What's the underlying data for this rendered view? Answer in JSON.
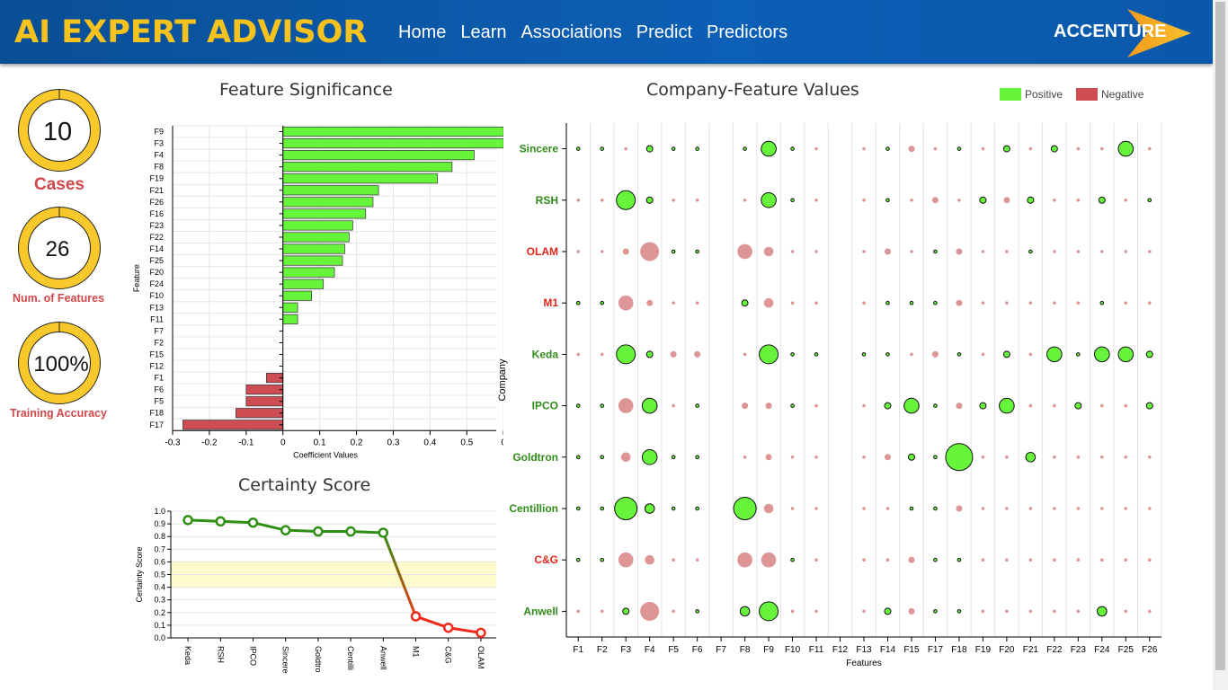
{
  "header": {
    "brand": "AI EXPERT ADVISOR",
    "nav": [
      "Home",
      "Learn",
      "Associations",
      "Predict",
      "Predictors"
    ],
    "logo": "ACCENTURE"
  },
  "colors": {
    "positive": "#66f53a",
    "negative": "#cd4d52",
    "gold": "#f9c82b",
    "bar": "#0b5cb0"
  },
  "kpis": [
    {
      "value": "10",
      "label": "Cases",
      "fill": 1.0
    },
    {
      "value": "26",
      "label": "Num. of Features",
      "fill": 1.0
    },
    {
      "value": "100%",
      "label": "Training Accuracy",
      "fill": 1.0
    }
  ],
  "chart_data": [
    {
      "type": "bar",
      "title": "Feature Significance",
      "xlabel": "Coefficient Values",
      "ylabel": "Feature",
      "xlim": [
        -0.3,
        0.58
      ],
      "xticks": [
        "-0.3",
        "-0.2",
        "-0.1",
        "0",
        "0.1",
        "0.2",
        "0.3",
        "0.4",
        "0.5",
        "0"
      ],
      "categories": [
        "F9",
        "F3",
        "F4",
        "F8",
        "F19",
        "F21",
        "F26",
        "F16",
        "F23",
        "F22",
        "F14",
        "F25",
        "F20",
        "F24",
        "F10",
        "F13",
        "F11",
        "F7",
        "F2",
        "F15",
        "F12",
        "F1",
        "F6",
        "F5",
        "F18",
        "F17"
      ],
      "values": [
        0.6,
        0.6,
        0.52,
        0.46,
        0.42,
        0.26,
        0.245,
        0.225,
        0.19,
        0.18,
        0.168,
        0.162,
        0.14,
        0.11,
        0.078,
        0.04,
        0.04,
        0,
        0,
        0,
        0,
        -0.045,
        -0.1,
        -0.1,
        -0.128,
        -0.272
      ]
    },
    {
      "type": "line",
      "title": "Certainty Score",
      "ylabel": "Certainty Score",
      "ylim": [
        0,
        1
      ],
      "yticks": [
        "0.0",
        "0.1",
        "0.2",
        "0.3",
        "0.4",
        "0.5",
        "0.6",
        "0.7",
        "0.8",
        "0.9",
        "1.0"
      ],
      "categories": [
        "Keda",
        "RSH",
        "IPCO",
        "Sincere",
        "Goldtro",
        "Centilli",
        "Anwell",
        "M1",
        "C&G",
        "OLAM"
      ],
      "values": [
        0.93,
        0.92,
        0.91,
        0.85,
        0.84,
        0.84,
        0.83,
        0.17,
        0.08,
        0.04
      ],
      "band": [
        0.4,
        0.6
      ]
    },
    {
      "type": "scatter",
      "title": "Company-Feature Values",
      "xlabel": "Features",
      "ylabel": "Company",
      "legend": [
        "Positive",
        "Negative"
      ],
      "features": [
        "F1",
        "F2",
        "F3",
        "F4",
        "F5",
        "F6",
        "F7",
        "F8",
        "F9",
        "F10",
        "F11",
        "F12",
        "F13",
        "F14",
        "F15",
        "F17",
        "F18",
        "F19",
        "F20",
        "F21",
        "F22",
        "F23",
        "F24",
        "F25",
        "F26"
      ],
      "companies": [
        {
          "name": "Sincere",
          "status": "pos"
        },
        {
          "name": "RSH",
          "status": "pos"
        },
        {
          "name": "OLAM",
          "status": "neg"
        },
        {
          "name": "M1",
          "status": "neg"
        },
        {
          "name": "Keda",
          "status": "pos"
        },
        {
          "name": "IPCO",
          "status": "pos"
        },
        {
          "name": "Goldtron",
          "status": "pos"
        },
        {
          "name": "Centillion",
          "status": "pos"
        },
        {
          "name": "C&G",
          "status": "neg"
        },
        {
          "name": "Anwell",
          "status": "pos"
        }
      ],
      "points": [
        [
          "p1",
          "p1",
          "n1",
          "p2",
          "p1",
          "p1",
          0,
          "p1",
          "p4",
          "p1",
          "n1",
          0,
          "n1",
          "p1",
          "n2",
          "n1",
          "p1",
          "n1",
          "p2",
          "n1",
          "p2",
          "n1",
          "n1",
          "p4",
          "n1"
        ],
        [
          "n1",
          "n1",
          "p5",
          "p2",
          "n1",
          "n1",
          0,
          "n1",
          "p4",
          "p1",
          "n1",
          0,
          "n1",
          "p1",
          "n1",
          "n2",
          "n1",
          "p2",
          "n2",
          "p2",
          "n1",
          "n1",
          "p2",
          "n1",
          "p1"
        ],
        [
          "n1",
          "n1",
          "n2",
          "n5",
          "p1",
          "p1",
          0,
          "n4",
          "n3",
          "n1",
          "n1",
          0,
          "n1",
          "n2",
          "n1",
          "p1",
          "n2",
          "n1",
          "n1",
          "p1",
          "n1",
          "n1",
          "n1",
          "n1",
          "n1"
        ],
        [
          "p1",
          "p1",
          "n4",
          "n2",
          "n1",
          "n1",
          0,
          "p2",
          "n3",
          "n1",
          "n1",
          0,
          "n1",
          "p1",
          "p1",
          "p1",
          "n2",
          "n1",
          "n1",
          "n1",
          "n1",
          "n1",
          "p1",
          "n1",
          "n1"
        ],
        [
          "n1",
          "n1",
          "p5",
          "p2",
          "n2",
          "n2",
          0,
          "n1",
          "p5",
          "p1",
          "p1",
          0,
          "p1",
          "p1",
          "n1",
          "n2",
          "p1",
          "n1",
          "p2",
          "n1",
          "p4",
          "p1",
          "p4",
          "p4",
          "p2"
        ],
        [
          "p1",
          "p1",
          "n4",
          "p4",
          "n1",
          "p1",
          0,
          "n2",
          "n2",
          "p1",
          "n1",
          0,
          "n1",
          "p2",
          "p4",
          "p1",
          "n2",
          "p2",
          "p4",
          "n1",
          "n1",
          "p2",
          "n1",
          "n1",
          "p2"
        ],
        [
          "p1",
          "p1",
          "n3",
          "p4",
          "p1",
          "p1",
          0,
          "n1",
          "n2",
          "n1",
          "n1",
          0,
          "n1",
          "n2",
          "p2",
          "p1",
          "p7",
          "n1",
          "n1",
          "p3",
          "n1",
          "n1",
          "n1",
          "n1",
          "n1"
        ],
        [
          "p1",
          "p1",
          "p6",
          "p3",
          "p1",
          "p1",
          0,
          "p6",
          "n3",
          "n1",
          "n1",
          0,
          "n1",
          "n1",
          "p1",
          "p1",
          "n2",
          "n1",
          "n1",
          "n1",
          "n1",
          "n1",
          "n1",
          "n1",
          "n1"
        ],
        [
          "p1",
          "p1",
          "n4",
          "n3",
          "n1",
          "n1",
          0,
          "n4",
          "n4",
          "p1",
          "n1",
          0,
          "n1",
          "n1",
          "n2",
          "p1",
          "p1",
          "n1",
          "n1",
          "n1",
          "n1",
          "n1",
          "n1",
          "n1",
          "n1"
        ],
        [
          "n1",
          "n1",
          "p2",
          "n5",
          "n1",
          "p1",
          0,
          "p3",
          "p5",
          "n1",
          "n1",
          0,
          "n1",
          "p2",
          "n2",
          "p1",
          "p1",
          "n1",
          "n1",
          "n1",
          "n1",
          "n1",
          "p3",
          "n1",
          "n1"
        ]
      ]
    }
  ]
}
